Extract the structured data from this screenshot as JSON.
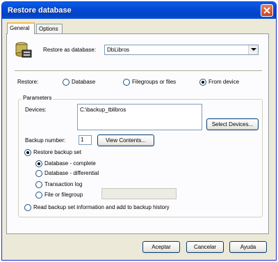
{
  "window": {
    "title": "Restore database"
  },
  "tabs": [
    {
      "label": "General"
    },
    {
      "label": "Options"
    }
  ],
  "restore_as": {
    "label": "Restore as database:",
    "value": "DbLibros"
  },
  "restore": {
    "label": "Restore:",
    "options": [
      {
        "label": "Database",
        "selected": false
      },
      {
        "label": "Filegroups or files",
        "selected": false
      },
      {
        "label": "From device",
        "selected": true
      }
    ]
  },
  "parameters": {
    "title": "Parameters",
    "devices_label": "Devices:",
    "devices": [
      "C:\\backup_tblibros"
    ],
    "select_devices_label": "Select Devices...",
    "backup_number_label": "Backup number:",
    "backup_number": "1",
    "view_contents_label": "View Contents...",
    "restore_backup_set_label": "Restore backup set",
    "backup_set_options": [
      {
        "label": "Database - complete",
        "selected": true
      },
      {
        "label": "Database - differential",
        "selected": false
      },
      {
        "label": "Transaction log",
        "selected": false
      },
      {
        "label": "File or filegroup",
        "selected": false
      }
    ],
    "read_info_label": "Read backup set information and add to backup history"
  },
  "footer": {
    "ok_label": "Aceptar",
    "cancel_label": "Cancelar",
    "help_label": "Ayuda"
  }
}
